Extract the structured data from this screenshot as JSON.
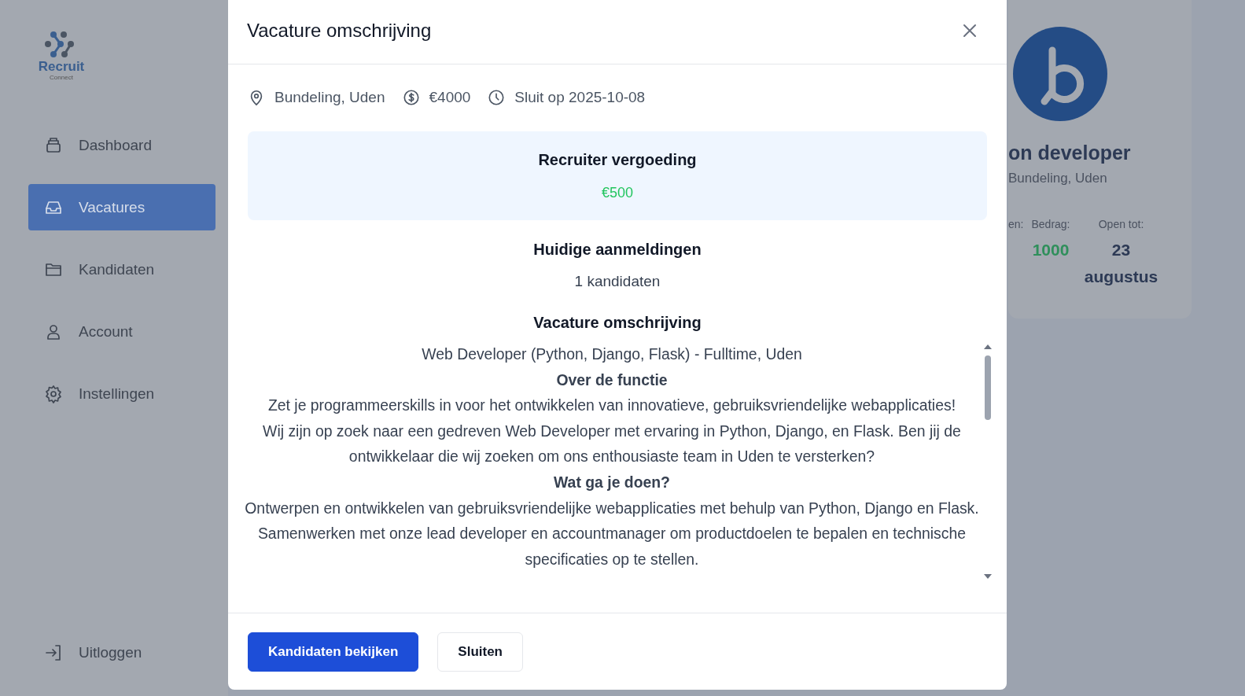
{
  "sidebar": {
    "logo": {
      "name": "Recruit",
      "tagline": "Connect"
    },
    "items": [
      {
        "label": "Dashboard",
        "selected": false
      },
      {
        "label": "Vacatures",
        "selected": true
      },
      {
        "label": "Kandidaten",
        "selected": false
      },
      {
        "label": "Account",
        "selected": false
      },
      {
        "label": "Instellingen",
        "selected": false
      }
    ],
    "logout": "Uitloggen"
  },
  "card": {
    "title": "on developer",
    "location": "Bundeling, Uden",
    "stats": [
      {
        "label": "en:"
      },
      {
        "label": "Bedrag:",
        "value": "1000",
        "kind": "money"
      },
      {
        "label": "Open tot:",
        "value": "23 augustus",
        "kind": "date"
      }
    ]
  },
  "modal": {
    "title": "Vacature omschrijving",
    "meta": [
      {
        "text": "Bundeling, Uden"
      },
      {
        "text": "€4000"
      },
      {
        "text": "Sluit op 2025-10-08"
      }
    ],
    "fee": {
      "label": "Recruiter vergoeding",
      "value": "€500"
    },
    "applications": {
      "label": "Huidige aanmeldingen",
      "value": "1 kandidaten"
    },
    "description_title": "Vacature omschrijving",
    "description": [
      {
        "kind": "text",
        "text": "Web Developer (Python, Django, Flask) - Fulltime, Uden"
      },
      {
        "kind": "heading",
        "text": "Over de functie"
      },
      {
        "kind": "text",
        "text": "Zet je programmeerskills in voor het ontwikkelen van innovatieve, gebruiksvriendelijke webapplicaties!"
      },
      {
        "kind": "text",
        "text": "Wij zijn op zoek naar een gedreven Web Developer met ervaring in Python, Django, en Flask. Ben jij de ontwikkelaar die wij zoeken om ons enthousiaste team in Uden te versterken?"
      },
      {
        "kind": "heading",
        "text": "Wat ga je doen?"
      },
      {
        "kind": "text",
        "text": "Ontwerpen en ontwikkelen van gebruiksvriendelijke webapplicaties met behulp van Python, Django en Flask."
      },
      {
        "kind": "text",
        "text": "Samenwerken met onze lead developer en accountmanager om productdoelen te bepalen en technische specificaties op te stellen."
      }
    ],
    "buttons": [
      {
        "label": "Kandidaten bekijken",
        "kind": "primary"
      },
      {
        "label": "Sluiten",
        "kind": "secondary"
      }
    ]
  }
}
